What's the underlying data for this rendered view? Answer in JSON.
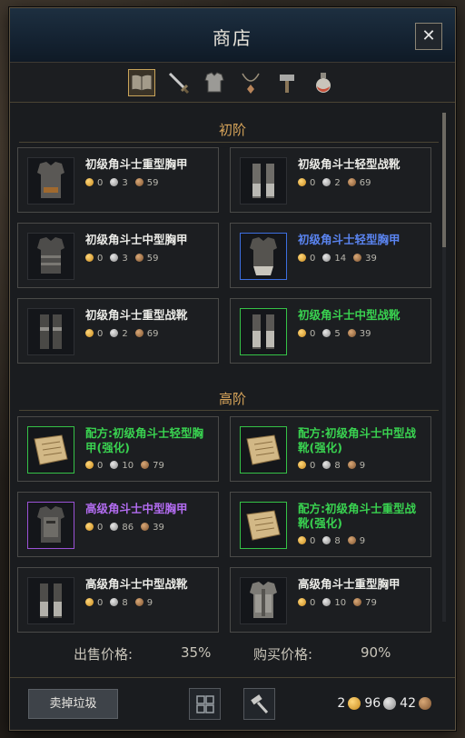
{
  "window": {
    "title": "商店"
  },
  "tabs": [
    {
      "icon": "book-icon",
      "active": true
    },
    {
      "icon": "sword-icon",
      "active": false
    },
    {
      "icon": "armor-icon",
      "active": false
    },
    {
      "icon": "necklace-icon",
      "active": false
    },
    {
      "icon": "hammer-icon",
      "active": false
    },
    {
      "icon": "potion-icon",
      "active": false
    }
  ],
  "sections": {
    "basic": "初阶",
    "advanced": "高阶"
  },
  "items": [
    {
      "name": "初级角斗士重型胸甲",
      "gold": "0",
      "silver": "3",
      "copper": "59",
      "rarity": "common",
      "icon": "heavy-chest-armor-icon"
    },
    {
      "name": "初级角斗士轻型战靴",
      "gold": "0",
      "silver": "2",
      "copper": "69",
      "rarity": "common",
      "icon": "light-boots-icon"
    },
    {
      "name": "初级角斗士中型胸甲",
      "gold": "0",
      "silver": "3",
      "copper": "59",
      "rarity": "common",
      "icon": "medium-chest-armor-icon"
    },
    {
      "name": "初级角斗士轻型胸甲",
      "gold": "0",
      "silver": "14",
      "copper": "39",
      "rarity": "blue",
      "icon": "light-chest-armor-icon"
    },
    {
      "name": "初级角斗士重型战靴",
      "gold": "0",
      "silver": "2",
      "copper": "69",
      "rarity": "common",
      "icon": "heavy-boots-icon"
    },
    {
      "name": "初级角斗士中型战靴",
      "gold": "0",
      "silver": "5",
      "copper": "39",
      "rarity": "green",
      "icon": "medium-boots-icon"
    },
    {
      "name": "配方:初级角斗士轻型胸甲(强化)",
      "gold": "0",
      "silver": "10",
      "copper": "79",
      "rarity": "green",
      "icon": "recipe-scroll-icon"
    },
    {
      "name": "配方:初级角斗士中型战靴(强化)",
      "gold": "0",
      "silver": "8",
      "copper": "9",
      "rarity": "green",
      "icon": "recipe-scroll-icon"
    },
    {
      "name": "高级角斗士中型胸甲",
      "gold": "0",
      "silver": "86",
      "copper": "39",
      "rarity": "purple",
      "icon": "advanced-chest-armor-icon"
    },
    {
      "name": "配方:初级角斗士重型战靴(强化)",
      "gold": "0",
      "silver": "8",
      "copper": "9",
      "rarity": "green",
      "icon": "recipe-scroll-icon"
    },
    {
      "name": "高级角斗士中型战靴",
      "gold": "0",
      "silver": "8",
      "copper": "9",
      "rarity": "common",
      "icon": "advanced-boots-icon"
    },
    {
      "name": "高级角斗士重型胸甲",
      "gold": "0",
      "silver": "10",
      "copper": "79",
      "rarity": "common",
      "icon": "advanced-heavy-chest-icon"
    }
  ],
  "rates": {
    "sell_label": "出售价格:",
    "sell_value": "35%",
    "buy_label": "购买价格:",
    "buy_value": "90%"
  },
  "footer": {
    "sell_junk_label": "卖掉垃圾",
    "grid_icon": "grid-icon",
    "repair_icon": "hammer-icon"
  },
  "wallet": {
    "gold": "2",
    "silver": "96",
    "copper": "42"
  },
  "colors": {
    "title_bar": "#142231",
    "section": "#d7a45a",
    "blue": "#5a84f0",
    "green": "#39d250",
    "purple": "#b26cf0"
  }
}
